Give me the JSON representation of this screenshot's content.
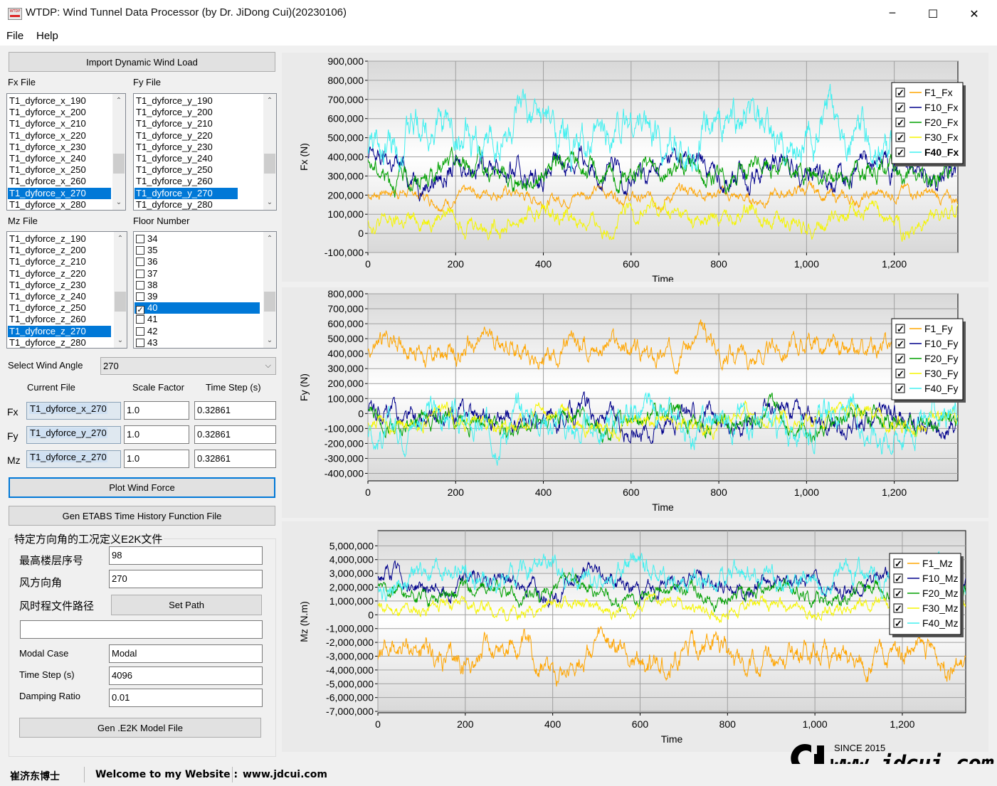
{
  "window": {
    "title": "WTDP: Wind Tunnel Data Processor (by Dr. JiDong Cui)(20230106)",
    "icon_text": "WTDP",
    "minimize": "─",
    "maximize": "☐",
    "close": "✕"
  },
  "menu": [
    "File",
    "Help"
  ],
  "import_button": "Import Dynamic Wind Load",
  "fx_file_label": "Fx File",
  "fy_file_label": "Fy File",
  "mz_file_label": "Mz File",
  "floor_number_label": "Floor Number",
  "fx_files": [
    "T1_dyforce_x_190",
    "T1_dyforce_x_200",
    "T1_dyforce_x_210",
    "T1_dyforce_x_220",
    "T1_dyforce_x_230",
    "T1_dyforce_x_240",
    "T1_dyforce_x_250",
    "T1_dyforce_x_260",
    "T1_dyforce_x_270",
    "T1_dyforce_x_280"
  ],
  "fy_files": [
    "T1_dyforce_y_190",
    "T1_dyforce_y_200",
    "T1_dyforce_y_210",
    "T1_dyforce_y_220",
    "T1_dyforce_y_230",
    "T1_dyforce_y_240",
    "T1_dyforce_y_250",
    "T1_dyforce_y_260",
    "T1_dyforce_y_270",
    "T1_dyforce_y_280"
  ],
  "mz_files": [
    "T1_dyforce_z_190",
    "T1_dyforce_z_200",
    "T1_dyforce_z_210",
    "T1_dyforce_z_220",
    "T1_dyforce_z_230",
    "T1_dyforce_z_240",
    "T1_dyforce_z_250",
    "T1_dyforce_z_260",
    "T1_dyforce_z_270",
    "T1_dyforce_z_280"
  ],
  "selected_file_index": 8,
  "floors": [
    "34",
    "35",
    "36",
    "37",
    "38",
    "39",
    "40",
    "41",
    "42",
    "43"
  ],
  "selected_floor": "40",
  "select_wind_angle_label": "Select Wind Angle",
  "wind_angle": "270",
  "table_headers": {
    "current_file": "Current File",
    "scale_factor": "Scale Factor",
    "time_step": "Time Step (s)"
  },
  "rows": [
    {
      "label": "Fx",
      "file": "T1_dyforce_x_270",
      "scale": "1.0",
      "step": "0.32861"
    },
    {
      "label": "Fy",
      "file": "T1_dyforce_y_270",
      "scale": "1.0",
      "step": "0.32861"
    },
    {
      "label": "Mz",
      "file": "T1_dyforce_z_270",
      "scale": "1.0",
      "step": "0.32861"
    }
  ],
  "plot_button": "Plot Wind Force",
  "gen_etabs_button": "Gen ETABS Time History Function File",
  "e2k_group": {
    "title": "特定方向角的工况定义E2K文件",
    "top_floor_label": "最高楼层序号",
    "top_floor_value": "98",
    "wind_dir_label": "风方向角",
    "wind_dir_value": "270",
    "path_label": "风时程文件路径",
    "set_path_button": "Set Path",
    "path_value": "",
    "modal_case_label": "Modal Case",
    "modal_case_value": "Modal",
    "time_step_label": "Time Step (s)",
    "time_step_value": "4096",
    "damping_label": "Damping Ratio",
    "damping_value": "0.01",
    "gen_button": "Gen .E2K Model File"
  },
  "status": {
    "name": "崔济东博士",
    "welcome": "Welcome to my Website :",
    "url": "www.jdcui.com"
  },
  "watermark": {
    "since": "SINCE 2015",
    "url": "www.jdcui.com"
  },
  "series_colors": {
    "F1": "#ffa500",
    "F10": "#00008b",
    "F20": "#00a000",
    "F30": "#f5f500",
    "F40": "#40f0f0"
  },
  "chart_data": [
    {
      "type": "line",
      "xlabel": "Time",
      "ylabel": "Fx (N)",
      "xlim": [
        0,
        1345
      ],
      "ylim": [
        -100000,
        900000
      ],
      "xticks": [
        "0",
        "200",
        "400",
        "600",
        "800",
        "1,000",
        "1,200"
      ],
      "yticks": [
        "-100,000",
        "0",
        "100,000",
        "200,000",
        "300,000",
        "400,000",
        "500,000",
        "600,000",
        "700,000",
        "800,000",
        "900,000"
      ],
      "grid": true,
      "legend_position": "right",
      "series": [
        {
          "name": "F1_Fx",
          "color": "#ffa500",
          "mean": 200000,
          "amp": 40000,
          "checked": true
        },
        {
          "name": "F10_Fx",
          "color": "#00008b",
          "mean": 340000,
          "amp": 80000,
          "checked": true
        },
        {
          "name": "F20_Fx",
          "color": "#00a000",
          "mean": 320000,
          "amp": 70000,
          "checked": true
        },
        {
          "name": "F30_Fx",
          "color": "#f5f500",
          "mean": 80000,
          "amp": 60000,
          "checked": true
        },
        {
          "name": "F40_Fx",
          "color": "#40f0f0",
          "mean": 510000,
          "amp": 120000,
          "checked": true,
          "bold": true
        }
      ]
    },
    {
      "type": "line",
      "xlabel": "Time",
      "ylabel": "Fy (N)",
      "xlim": [
        0,
        1345
      ],
      "ylim": [
        -450000,
        800000
      ],
      "xticks": [
        "0",
        "200",
        "400",
        "600",
        "800",
        "1,000",
        "1,200"
      ],
      "yticks": [
        "-400,000",
        "-300,000",
        "-200,000",
        "-100,000",
        "0",
        "100,000",
        "200,000",
        "300,000",
        "400,000",
        "500,000",
        "600,000",
        "700,000",
        "800,000"
      ],
      "grid": true,
      "legend_position": "right",
      "series": [
        {
          "name": "F1_Fy",
          "color": "#ffa500",
          "mean": 430000,
          "amp": 90000,
          "checked": true
        },
        {
          "name": "F10_Fy",
          "color": "#00008b",
          "mean": -40000,
          "amp": 90000,
          "checked": true
        },
        {
          "name": "F20_Fy",
          "color": "#00a000",
          "mean": -40000,
          "amp": 80000,
          "checked": true
        },
        {
          "name": "F30_Fy",
          "color": "#f5f500",
          "mean": -40000,
          "amp": 70000,
          "checked": true
        },
        {
          "name": "F40_Fy",
          "color": "#40f0f0",
          "mean": -60000,
          "amp": 120000,
          "checked": true
        }
      ]
    },
    {
      "type": "line",
      "xlabel": "Time",
      "ylabel": "Mz (N.m)",
      "xlim": [
        0,
        1345
      ],
      "ylim": [
        -7100000,
        6100000
      ],
      "xticks": [
        "0",
        "200",
        "400",
        "600",
        "800",
        "1,000",
        "1,200"
      ],
      "yticks": [
        "-7,000,000",
        "-6,000,000",
        "-5,000,000",
        "-4,000,000",
        "-3,000,000",
        "-2,000,000",
        "-1,000,000",
        "0",
        "1,000,000",
        "2,000,000",
        "3,000,000",
        "4,000,000",
        "5,000,000"
      ],
      "grid": true,
      "legend_position": "right",
      "series": [
        {
          "name": "F1_Mz",
          "color": "#ffa500",
          "mean": -3000000,
          "amp": 1100000,
          "checked": true
        },
        {
          "name": "F10_Mz",
          "color": "#00008b",
          "mean": 2300000,
          "amp": 800000,
          "checked": true
        },
        {
          "name": "F20_Mz",
          "color": "#00a000",
          "mean": 1600000,
          "amp": 700000,
          "checked": true
        },
        {
          "name": "F30_Mz",
          "color": "#f5f500",
          "mean": 500000,
          "amp": 600000,
          "checked": true
        },
        {
          "name": "F40_Mz",
          "color": "#40f0f0",
          "mean": 2800000,
          "amp": 1000000,
          "checked": true
        }
      ]
    }
  ]
}
